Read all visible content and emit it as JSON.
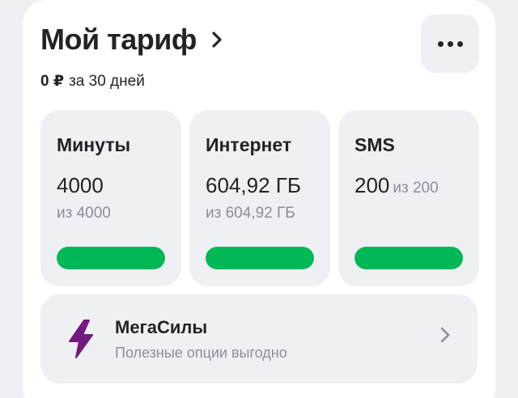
{
  "tariff": {
    "title": "Мой тариф",
    "price": "0 ₽",
    "period": "за 30 дней"
  },
  "tiles": [
    {
      "title": "Минуты",
      "value": "4000",
      "of": "из 4000",
      "remaining_fraction": 1.0
    },
    {
      "title": "Интернет",
      "value": "604,92 ГБ",
      "of": "из 604,92 ГБ",
      "remaining_fraction": 1.0
    },
    {
      "title": "SMS",
      "value": "200",
      "of": "из 200",
      "remaining_fraction": 1.0
    }
  ],
  "promo": {
    "title": "МегаСилы",
    "subtitle": "Полезные опции выгодно",
    "icon": "lightning-icon"
  },
  "colors": {
    "accent_green": "#00b956",
    "promo_purple": "#731982",
    "text_primary": "#222326",
    "text_secondary": "#8a8f99",
    "tile_bg": "#eef0f4"
  }
}
